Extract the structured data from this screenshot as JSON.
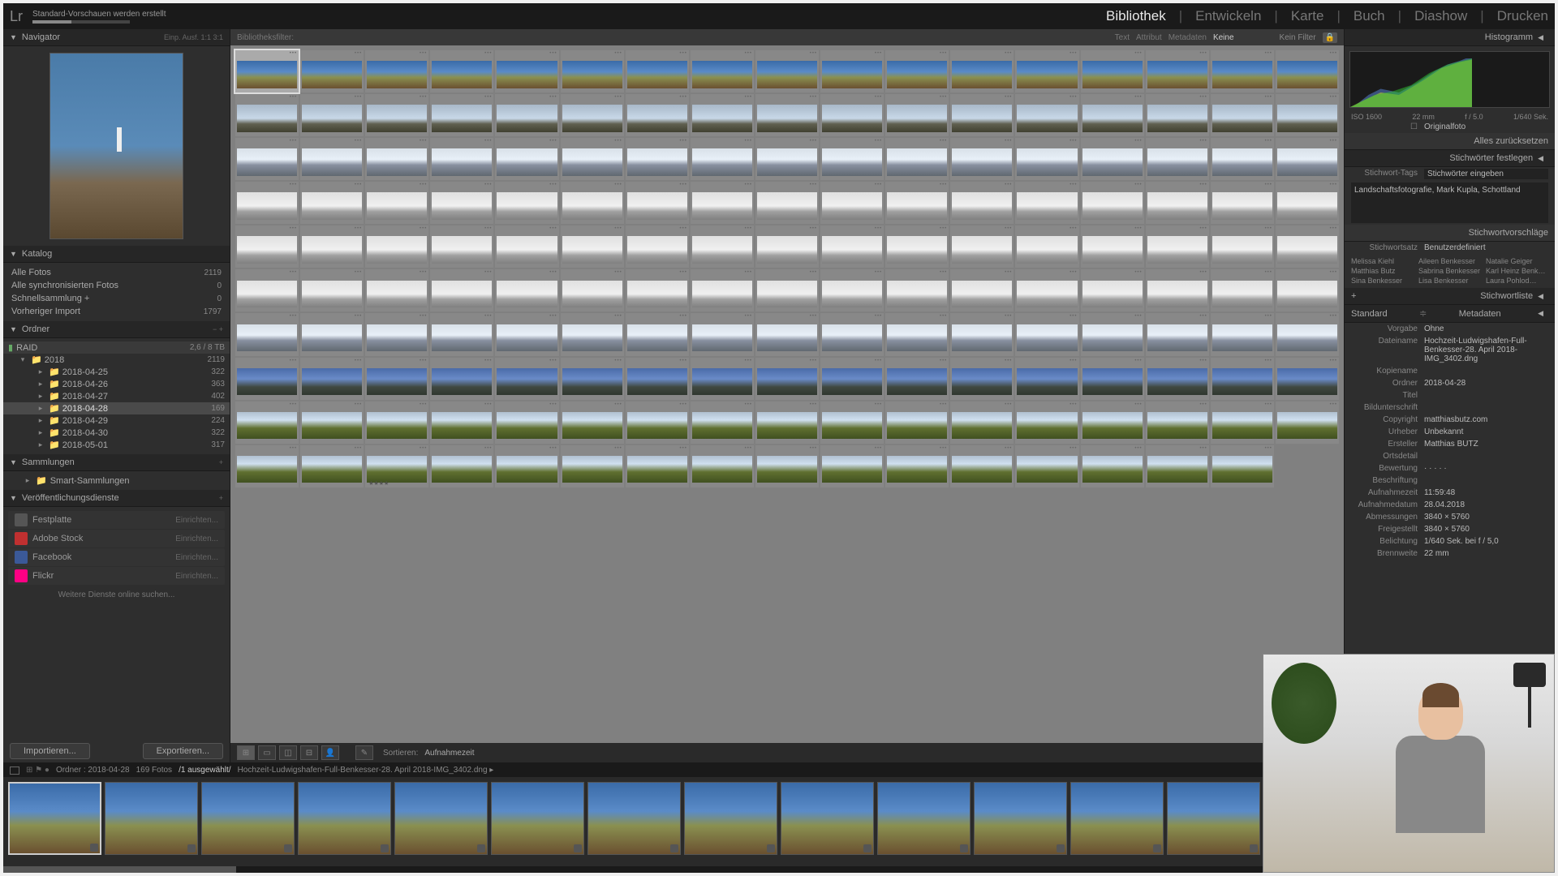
{
  "topbar": {
    "logo": "Lr",
    "progress_label": "Standard-Vorschauen werden erstellt"
  },
  "modules": {
    "library": "Bibliothek",
    "develop": "Entwickeln",
    "map": "Karte",
    "book": "Buch",
    "slideshow": "Diashow",
    "print": "Drucken"
  },
  "navigator": {
    "title": "Navigator",
    "modes": "Einp.   Ausf.   1:1   3:1"
  },
  "catalog": {
    "title": "Katalog",
    "all_photos": "Alle Fotos",
    "all_photos_count": "2119",
    "synced": "Alle synchronisierten Fotos",
    "synced_count": "0",
    "quick": "Schnellsammlung  +",
    "quick_count": "0",
    "prev_import": "Vorheriger Import",
    "prev_import_count": "1797"
  },
  "folders": {
    "title": "Ordner",
    "drive": "RAID",
    "drive_info": "2,6 / 8 TB",
    "root": "2018",
    "root_count": "2119",
    "items": [
      {
        "name": "2018-04-25",
        "count": "322"
      },
      {
        "name": "2018-04-26",
        "count": "363"
      },
      {
        "name": "2018-04-27",
        "count": "402"
      },
      {
        "name": "2018-04-28",
        "count": "169",
        "selected": true
      },
      {
        "name": "2018-04-29",
        "count": "224"
      },
      {
        "name": "2018-04-30",
        "count": "322"
      },
      {
        "name": "2018-05-01",
        "count": "317"
      }
    ]
  },
  "collections": {
    "title": "Sammlungen",
    "smart": "Smart-Sammlungen"
  },
  "publish": {
    "title": "Veröffentlichungsdienste",
    "items": [
      {
        "name": "Festplatte",
        "action": "Einrichten...",
        "color": "#555"
      },
      {
        "name": "Adobe Stock",
        "action": "Einrichten...",
        "color": "#c03030"
      },
      {
        "name": "Facebook",
        "action": "Einrichten...",
        "color": "#3b5998"
      },
      {
        "name": "Flickr",
        "action": "Einrichten...",
        "color": "#ff0084"
      }
    ],
    "more": "Weitere Dienste online suchen..."
  },
  "filter_bar": {
    "label": "Bibliotheksfilter:",
    "tabs": [
      "Text",
      "Attribut",
      "Metadaten",
      "Keine"
    ],
    "no_filter": "Kein Filter"
  },
  "toolbar": {
    "sort_label": "Sortieren:",
    "sort_value": "Aufnahmezeit"
  },
  "actions": {
    "import": "Importieren...",
    "export": "Exportieren..."
  },
  "status": {
    "path": "Ordner : 2018-04-28",
    "count": "169 Fotos",
    "selected": "/1 ausgewählt/",
    "filename": "Hochzeit-Ludwigshafen-Full-Benkesser-28. April 2018-IMG_3402.dng  ▸"
  },
  "right": {
    "histogram_title": "Histogramm",
    "histo_info": [
      "ISO 1600",
      "22 mm",
      "f / 5.0",
      "1/640 Sek."
    ],
    "original": "Originalfoto",
    "reset_all": "Alles zurücksetzen",
    "keywords_title": "Stichwörter festlegen",
    "keyword_tags": "Stichwort-Tags",
    "keyword_input": "Stichwörter eingeben",
    "keyword_value": "Landschaftsfotografie, Mark Kupla, Schottland",
    "suggest_title": "Stichwortvorschläge",
    "suggest_set": "Stichwortsatz",
    "suggest_set_val": "Benutzerdefiniert",
    "suggestions": [
      "Melissa Kiehl",
      "Aileen Benkesser",
      "Natalie Geiger",
      "Matthias Butz",
      "Sabrina Benkesser",
      "Karl Heinz Benk…",
      "Sina Benkesser",
      "Lisa Benkesser",
      "Laura Pohlod…"
    ],
    "keyword_list": "Stichwortliste",
    "metadata_title": "Metadaten",
    "metadata_mode": "Standard",
    "fields": [
      {
        "label": "Vorgabe",
        "value": "Ohne"
      },
      {
        "label": "Dateiname",
        "value": "Hochzeit-Ludwigshafen-Full-Benkesser-28. April 2018-IMG_3402.dng"
      },
      {
        "label": "Kopiename",
        "value": ""
      },
      {
        "label": "Ordner",
        "value": "2018-04-28"
      },
      {
        "label": "Titel",
        "value": ""
      },
      {
        "label": "Bildunterschrift",
        "value": ""
      },
      {
        "label": "Copyright",
        "value": "matthiasbutz.com"
      },
      {
        "label": "Urheber",
        "value": "Unbekannt"
      },
      {
        "label": "Ersteller",
        "value": "Matthias BUTZ"
      },
      {
        "label": "Ortsdetail",
        "value": ""
      },
      {
        "label": "Bewertung",
        "value": "·  ·  ·  ·  ·"
      },
      {
        "label": "Beschriftung",
        "value": ""
      },
      {
        "label": "Aufnahmezeit",
        "value": "11:59:48"
      },
      {
        "label": "Aufnahmedatum",
        "value": "28.04.2018"
      },
      {
        "label": "Abmessungen",
        "value": "3840 × 5760"
      },
      {
        "label": "Freigestellt",
        "value": "3840 × 5760"
      },
      {
        "label": "Belichtung",
        "value": "1/640 Sek. bei f / 5,0"
      },
      {
        "label": "Brennweite",
        "value": "22 mm"
      }
    ]
  },
  "grid": {
    "rows": [
      {
        "style": "sky1",
        "count": 17,
        "selected": 0
      },
      {
        "style": "sky2",
        "count": 17
      },
      {
        "style": "sky3",
        "count": 17
      },
      {
        "style": "sky4",
        "count": 17
      },
      {
        "style": "sky4",
        "count": 17
      },
      {
        "style": "sky4",
        "count": 17
      },
      {
        "style": "sky3",
        "count": 17
      },
      {
        "style": "sky6",
        "count": 17
      },
      {
        "style": "sky5",
        "count": 17
      },
      {
        "style": "sky5",
        "count": 16,
        "rating_at": 2
      }
    ]
  },
  "filmstrip": {
    "count": 13
  }
}
